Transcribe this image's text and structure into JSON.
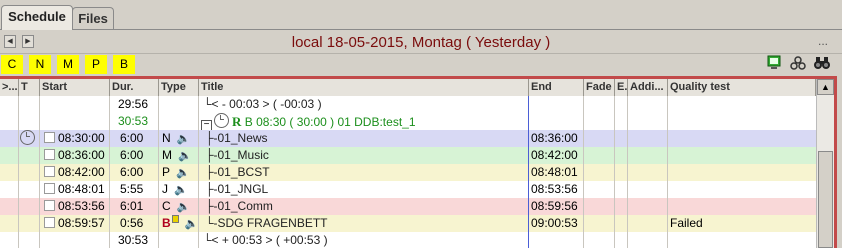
{
  "tabs": [
    {
      "label": "Schedule"
    },
    {
      "label": "Files"
    }
  ],
  "datebar": {
    "title": "local 18-05-2015, Montag ( Yesterday )",
    "menu": "..."
  },
  "filters": [
    "C",
    "N",
    "M",
    "P",
    "B"
  ],
  "toolbar_icons": [
    "monitor-icon",
    "recycle-icon",
    "binoculars-icon"
  ],
  "columns": ">...|T|Start|Dur.|Type|Title|End|Fade|E..|Addi...|Quality test",
  "column_list": [
    ">...",
    "T",
    "Start",
    "Dur.",
    "Type",
    "Title",
    "End",
    "Fade",
    "E.",
    "Addi...",
    "Quality test"
  ],
  "rows": [
    {
      "start": "",
      "dur": "29:56",
      "type": "",
      "title": "└< - 00:03 > ( -00:03 )",
      "end": "",
      "quality": "",
      "bg": "#ffffff",
      "dur_color": "#000000"
    },
    {
      "start": "",
      "dur": "30:53",
      "type": "",
      "title": "B 08:30 ( 30:00 ) 01 DDB:test_1",
      "title_prefix": "R",
      "end": "",
      "quality": "",
      "bg": "#ffffff",
      "dur_color": "#1c8f1c"
    },
    {
      "start": "08:30:00",
      "dur": "6:00",
      "type": "N",
      "title": "01_News",
      "end": "08:36:00",
      "quality": "",
      "bg": "#d8d9f4"
    },
    {
      "start": "08:36:00",
      "dur": "6:00",
      "type": "M",
      "title": "01_Music",
      "end": "08:42:00",
      "quality": "",
      "bg": "#d7f3d5"
    },
    {
      "start": "08:42:00",
      "dur": "6:00",
      "type": "P",
      "title": "01_BCST",
      "end": "08:48:01",
      "quality": "",
      "bg": "#f7f4d0"
    },
    {
      "start": "08:48:01",
      "dur": "5:55",
      "type": "J",
      "title": "01_JNGL",
      "end": "08:53:56",
      "quality": "",
      "bg": "#ffffff"
    },
    {
      "start": "08:53:56",
      "dur": "6:01",
      "type": "C",
      "title": "01_Comm",
      "end": "08:59:56",
      "quality": "",
      "bg": "#f9d8d8"
    },
    {
      "start": "08:59:57",
      "dur": "0:56",
      "type": "B",
      "title": "SDG FRAGENBETT",
      "end": "09:00:53",
      "quality": "Failed",
      "bg": "#f7f4d0"
    },
    {
      "start": "",
      "dur": "30:53",
      "type": "",
      "title": "└< + 00:53 > ( +00:53 )",
      "end": "",
      "quality": "",
      "bg": "#ffffff"
    }
  ]
}
